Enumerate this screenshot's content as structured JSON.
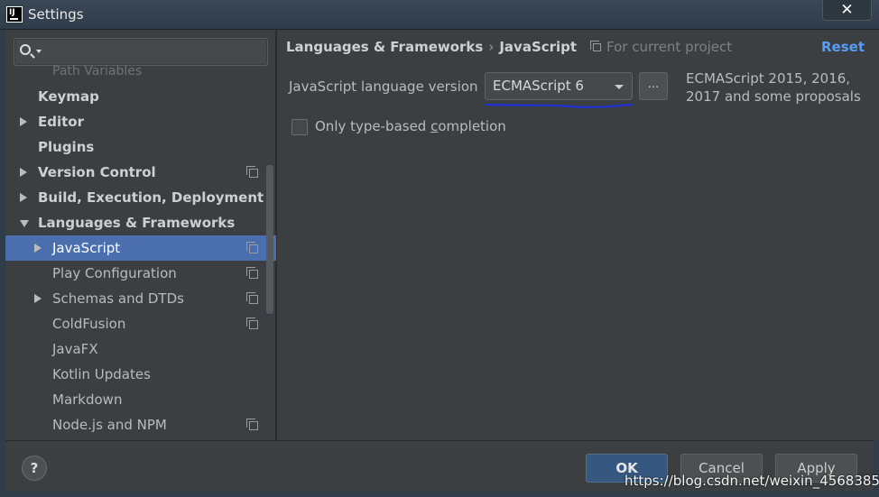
{
  "window": {
    "title": "Settings",
    "close_symbol": "✕"
  },
  "search": {
    "placeholder": ""
  },
  "sidebar": {
    "items": [
      {
        "label": "Path Variables",
        "level": "sub",
        "faded": true
      },
      {
        "label": "Keymap",
        "level": "top"
      },
      {
        "label": "Editor",
        "level": "top",
        "arrow": "right"
      },
      {
        "label": "Plugins",
        "level": "top"
      },
      {
        "label": "Version Control",
        "level": "top",
        "arrow": "right",
        "copy": true
      },
      {
        "label": "Build, Execution, Deployment",
        "level": "top",
        "arrow": "right"
      },
      {
        "label": "Languages & Frameworks",
        "level": "top",
        "arrow": "down"
      },
      {
        "label": "JavaScript",
        "level": "sub",
        "arrow": "right",
        "copy": true,
        "selected": true
      },
      {
        "label": "Play Configuration",
        "level": "sub",
        "copy": true
      },
      {
        "label": "Schemas and DTDs",
        "level": "sub",
        "arrow": "right",
        "copy": true
      },
      {
        "label": "ColdFusion",
        "level": "sub",
        "copy": true
      },
      {
        "label": "JavaFX",
        "level": "sub"
      },
      {
        "label": "Kotlin Updates",
        "level": "sub"
      },
      {
        "label": "Markdown",
        "level": "sub"
      },
      {
        "label": "Node.js and NPM",
        "level": "sub",
        "copy": true
      }
    ]
  },
  "main": {
    "breadcrumb": {
      "parent": "Languages & Frameworks",
      "separator": "›",
      "current": "JavaScript"
    },
    "scope_label": "For current project",
    "reset_label": "Reset",
    "language_version": {
      "label": "JavaScript language version",
      "selected": "ECMAScript 6",
      "ellipsis": "...",
      "description": "ECMAScript 2015, 2016, 2017 and some proposals"
    },
    "type_based": {
      "label_before": "Only type-based ",
      "label_mnemonic": "c",
      "label_after": "ompletion",
      "checked": false
    }
  },
  "footer": {
    "help": "?",
    "ok": "OK",
    "cancel": "Cancel",
    "apply": "Apply"
  },
  "watermark": "https://blog.csdn.net/weixin_45683851",
  "colors": {
    "selection": "#4b6eaf",
    "link": "#589df6",
    "annotation": "#1f2fd8",
    "ok_button": "#365880"
  }
}
